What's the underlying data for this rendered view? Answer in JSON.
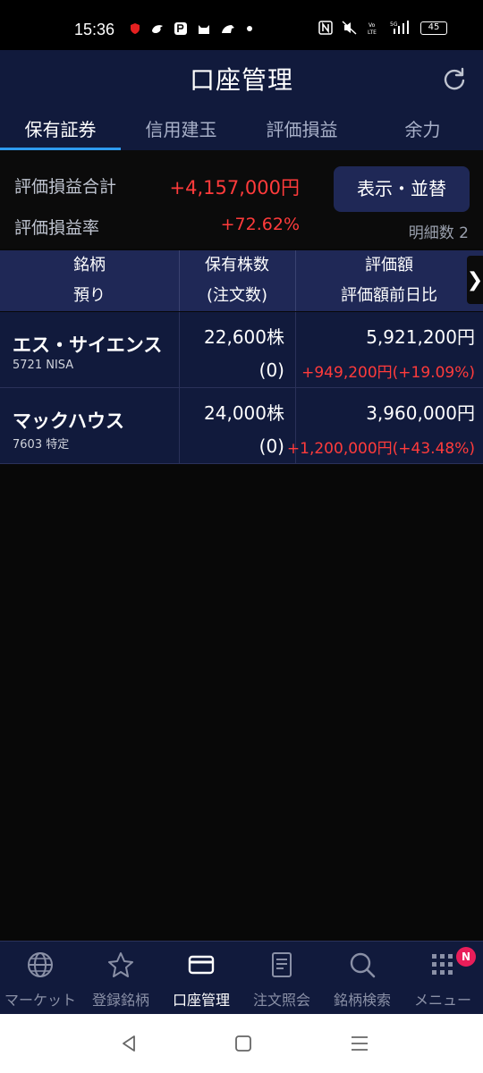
{
  "status_bar": {
    "time": "15:36",
    "battery": "45"
  },
  "header": {
    "title": "口座管理"
  },
  "tabs": [
    "保有証券",
    "信用建玉",
    "評価損益",
    "余力"
  ],
  "summary": {
    "total_label": "評価損益合計",
    "total_value": "+4,157,000円",
    "rate_label": "評価損益率",
    "rate_value": "+72.62%",
    "display_button": "表示・並替",
    "detail_count": "明細数 2"
  },
  "table": {
    "headers": {
      "col1_line1": "銘柄",
      "col1_line2": "預り",
      "col2_line1": "保有株数",
      "col2_line2": "(注文数)",
      "col3_line1": "評価額",
      "col3_line2": "評価額前日比"
    },
    "rows": [
      {
        "name": "エス・サイエンス",
        "code": "5721 NISA",
        "shares": "22,600株",
        "order": "(0)",
        "value": "5,921,200円",
        "diff": "+949,200円(+19.09%)"
      },
      {
        "name": "マックハウス",
        "code": "7603 特定",
        "shares": "24,000株",
        "order": "(0)",
        "value": "3,960,000円",
        "diff": "+1,200,000円(+43.48%)"
      }
    ]
  },
  "bottom_nav": [
    {
      "label": "マーケット",
      "icon": "globe-icon"
    },
    {
      "label": "登録銘柄",
      "icon": "star-icon"
    },
    {
      "label": "口座管理",
      "icon": "card-icon"
    },
    {
      "label": "注文照会",
      "icon": "document-icon"
    },
    {
      "label": "銘柄検索",
      "icon": "search-icon"
    },
    {
      "label": "メニュー",
      "icon": "grid-icon",
      "badge": "N"
    }
  ],
  "colors": {
    "header_bg": "#111a3c",
    "accent_blue": "#2e9bf0",
    "gain_red": "#ff3b3b",
    "button_bg": "#1f2856",
    "badge": "#e91e5a"
  }
}
